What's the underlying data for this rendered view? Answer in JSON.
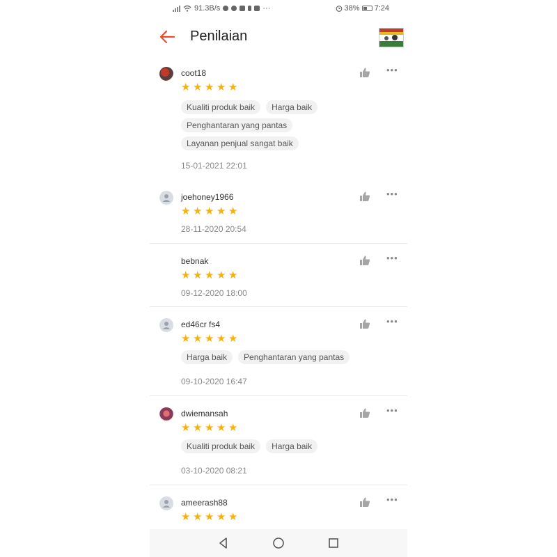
{
  "status": {
    "speed": "91.3B/s",
    "extra": "···",
    "battery_pct": "38%",
    "time": "7:24"
  },
  "header": {
    "title": "Penilaian"
  },
  "colors": {
    "accent": "#ee4d2d",
    "star": "#f6b10f"
  },
  "reviews": [
    {
      "username": "coot18",
      "avatar": "photo",
      "rating": 5,
      "tags": [
        [
          "Kualiti produk baik",
          "Harga baik"
        ],
        [
          "Penghantaran yang pantas"
        ],
        [
          "Layanan penjual sangat baik"
        ]
      ],
      "date": "15-01-2021 22:01"
    },
    {
      "username": "joehoney1966",
      "avatar": "default",
      "rating": 5,
      "tags": [],
      "date": "28-11-2020 20:54"
    },
    {
      "username": "bebnak",
      "avatar": "none",
      "rating": 5,
      "tags": [],
      "date": "09-12-2020 18:00"
    },
    {
      "username": "ed46cr fs4",
      "avatar": "default",
      "rating": 5,
      "tags": [
        [
          "Harga baik",
          "Penghantaran yang pantas"
        ]
      ],
      "date": "09-10-2020 16:47"
    },
    {
      "username": "dwiemansah",
      "avatar": "photo",
      "rating": 5,
      "tags": [
        [
          "Kualiti produk baik",
          "Harga baik"
        ]
      ],
      "date": "03-10-2020 08:21"
    },
    {
      "username": "ameerash88",
      "avatar": "default",
      "rating": 5,
      "tags": [],
      "date": ""
    }
  ]
}
